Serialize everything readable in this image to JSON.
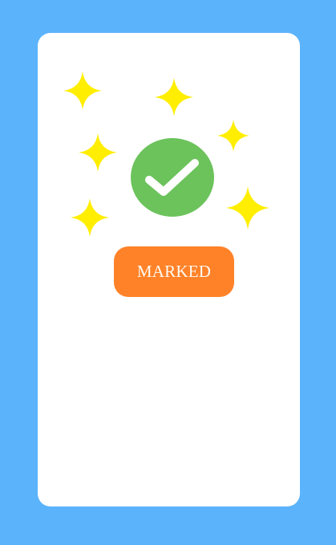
{
  "status": {
    "button_label": "MARKED",
    "check_icon": "check-icon",
    "sparkle_icon": "sparkle-icon"
  },
  "colors": {
    "background": "#5bb3fb",
    "card": "#ffffff",
    "sparkle": "#ffee00",
    "check_badge": "#6cc35c",
    "button": "#ff8229",
    "button_text": "#fffaf0"
  }
}
